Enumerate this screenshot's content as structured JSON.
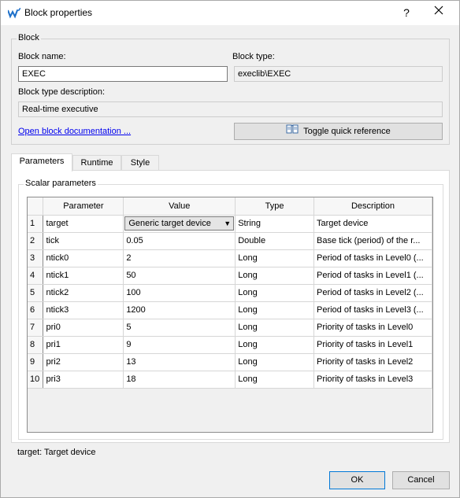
{
  "window": {
    "title": "Block properties",
    "help_label": "?",
    "close_label": "✕"
  },
  "block": {
    "group_title": "Block",
    "name_label": "Block name:",
    "name_value": "EXEC",
    "type_label": "Block type:",
    "type_value": "execlib\\EXEC",
    "description_label": "Block type description:",
    "description_value": "Real-time executive",
    "doc_link": "Open block documentation ...",
    "toggle_button": "Toggle quick reference"
  },
  "tabs": [
    {
      "label": "Parameters"
    },
    {
      "label": "Runtime"
    },
    {
      "label": "Style"
    }
  ],
  "scalar": {
    "group_title": "Scalar parameters",
    "columns": [
      "Parameter",
      "Value",
      "Type",
      "Description"
    ],
    "rows": [
      {
        "num": "1",
        "param": "target",
        "value": "Generic target device",
        "type": "String",
        "desc": "Target device"
      },
      {
        "num": "2",
        "param": "tick",
        "value": "0.05",
        "type": "Double",
        "desc": "Base tick (period) of the r..."
      },
      {
        "num": "3",
        "param": "ntick0",
        "value": "2",
        "type": "Long",
        "desc": "Period of tasks in Level0 (..."
      },
      {
        "num": "4",
        "param": "ntick1",
        "value": "50",
        "type": "Long",
        "desc": "Period of tasks in Level1 (..."
      },
      {
        "num": "5",
        "param": "ntick2",
        "value": "100",
        "type": "Long",
        "desc": "Period of tasks in Level2 (..."
      },
      {
        "num": "6",
        "param": "ntick3",
        "value": "1200",
        "type": "Long",
        "desc": "Period of tasks in Level3 (..."
      },
      {
        "num": "7",
        "param": "pri0",
        "value": "5",
        "type": "Long",
        "desc": "Priority of tasks in Level0"
      },
      {
        "num": "8",
        "param": "pri1",
        "value": "9",
        "type": "Long",
        "desc": "Priority of tasks in Level1"
      },
      {
        "num": "9",
        "param": "pri2",
        "value": "13",
        "type": "Long",
        "desc": "Priority of tasks in Level2"
      },
      {
        "num": "10",
        "param": "pri3",
        "value": "18",
        "type": "Long",
        "desc": "Priority of tasks in Level3"
      }
    ]
  },
  "status_text": "target: Target device",
  "buttons": {
    "ok": "OK",
    "cancel": "Cancel"
  },
  "colors": {
    "link": "#0000ee",
    "accent": "#0078d7"
  },
  "icons": {
    "app": "app-logo-icon",
    "book": "book-icon",
    "dropdown": "dropdown-arrow-icon"
  }
}
